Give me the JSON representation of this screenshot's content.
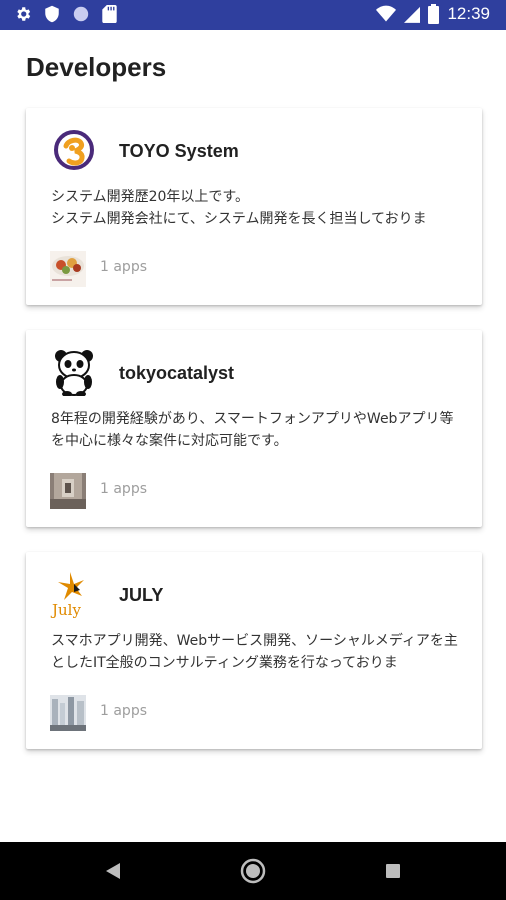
{
  "status_bar": {
    "time": "12:39",
    "left_icons": [
      "gear-icon",
      "shield-icon",
      "circle-icon",
      "sd-card-icon"
    ],
    "right_icons": [
      "wifi-icon",
      "signal-icon",
      "battery-icon"
    ]
  },
  "page": {
    "title": "Developers"
  },
  "developers": [
    {
      "name": "TOYO System",
      "description": "システム開発歴20年以上です。\nシステム開発会社にて、システム開発を長く担当しておりま",
      "apps": "1 apps",
      "logo": "toyo-logo-icon"
    },
    {
      "name": "tokyocatalyst",
      "description": "8年程の開発経験があり、スマートフォンアプリやWebアプリ等を中心に様々な案件に対応可能です。",
      "apps": "1 apps",
      "logo": "panda-icon"
    },
    {
      "name": "JULY",
      "description": "スマホアプリ開発、Webサービス開発、ソーシャルメディアを主としたIT全般のコンサルティング業務を行なっておりま",
      "apps": "1 apps",
      "logo": "july-logo-icon",
      "logo_text": "July"
    }
  ],
  "nav_bar": {
    "buttons": [
      "back-icon",
      "home-icon",
      "recents-icon"
    ]
  },
  "colors": {
    "status_bar": "#2f3f9e",
    "toyo_purple": "#4a2a7a",
    "toyo_orange": "#f0a020",
    "july_orange": "#e08a00"
  }
}
